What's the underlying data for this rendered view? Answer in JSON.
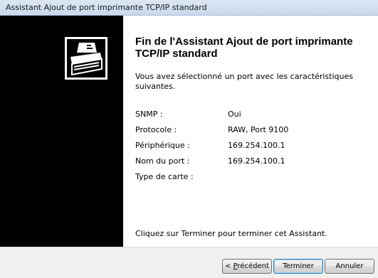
{
  "window": {
    "title": "Assistant Ajout de port imprimante TCP/IP standard"
  },
  "side": {
    "logo_icon": "printer-wizard-icon"
  },
  "content": {
    "heading": "Fin de l'Assistant Ajout de port imprimante TCP/IP standard",
    "intro": "Vous avez sélectionné un port avec les caractéristiques suivantes.",
    "details": [
      {
        "label": "SNMP :",
        "value": "Oui"
      },
      {
        "label": "Protocole :",
        "value": "RAW, Port 9100"
      },
      {
        "label": "Périphérique :",
        "value": "169.254.100.1"
      },
      {
        "label": "Nom du port :",
        "value": "169.254.100.1"
      },
      {
        "label": "Type de carte :",
        "value": ""
      }
    ],
    "finish_text": "Cliquez sur Terminer pour terminer cet Assistant."
  },
  "buttons": {
    "back_prefix": "< ",
    "back_accel": "P",
    "back_rest": "récédent",
    "finish": "Terminer",
    "cancel": "Annuler"
  }
}
